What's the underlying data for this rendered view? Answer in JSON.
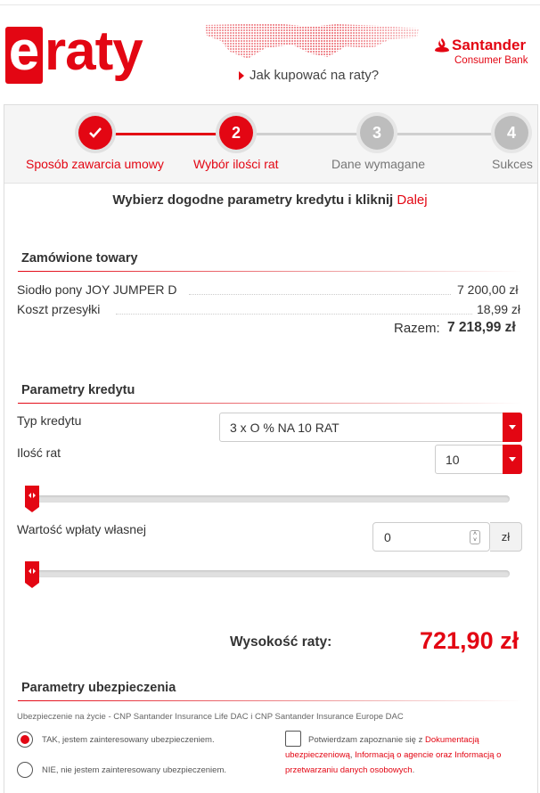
{
  "header": {
    "logo_e": "e",
    "logo_rest": "raty",
    "howto_link": "Jak kupować na raty?",
    "bank_name": "Santander",
    "bank_sub": "Consumer Bank"
  },
  "steps": [
    {
      "label": "Sposób zawarcia umowy",
      "number": "",
      "state": "done"
    },
    {
      "label": "Wybór ilości rat",
      "number": "2",
      "state": "active"
    },
    {
      "label": "Dane wymagane",
      "number": "3",
      "state": "inactive"
    },
    {
      "label": "Sukces",
      "number": "4",
      "state": "inactive"
    }
  ],
  "instruction": {
    "text": "Wybierz dogodne parametry kredytu i kliknij",
    "link": "Dalej"
  },
  "order": {
    "title": "Zamówione towary",
    "items": [
      {
        "name": "Siodło pony JOY JUMPER D",
        "price": "7 200,00 zł"
      },
      {
        "name": "Koszt przesyłki",
        "price": "18,99 zł"
      }
    ],
    "total_label": "Razem:",
    "total_value": "7 218,99 zł"
  },
  "credit": {
    "title": "Parametry kredytu",
    "type_label": "Typ kredytu",
    "type_value": "3 x O % NA 10 RAT",
    "count_label": "Ilość rat",
    "count_value": "10",
    "count_slider_fraction": 0,
    "down_payment_label": "Wartość wpłaty własnej",
    "down_payment_value": "0",
    "down_payment_unit": "zł",
    "down_payment_slider_fraction": 0
  },
  "installment": {
    "label": "Wysokość raty:",
    "value": "721,90 zł"
  },
  "insurance": {
    "title": "Parametry ubezpieczenia",
    "note": "Ubezpieczenie na życie - CNP Santander Insurance Life DAC i CNP Santander Insurance Europe DAC",
    "yes_label": "TAK, jestem zainteresowany ubezpieczeniem.",
    "no_label": "NIE, nie jestem zainteresowany ubezpieczeniem.",
    "selected": "yes",
    "confirm_prefix": "Potwierdzam zapoznanie się z",
    "confirm_link1": "Dokumentacją ubezpieczeniową",
    "confirm_sep": ",",
    "confirm_link2": "Informacją o agencie oraz Informacją o przetwarzaniu danych osobowych",
    "confirm_end": "."
  },
  "colors": {
    "accent": "#e30613",
    "inactive_step": "#bdbdbd"
  }
}
